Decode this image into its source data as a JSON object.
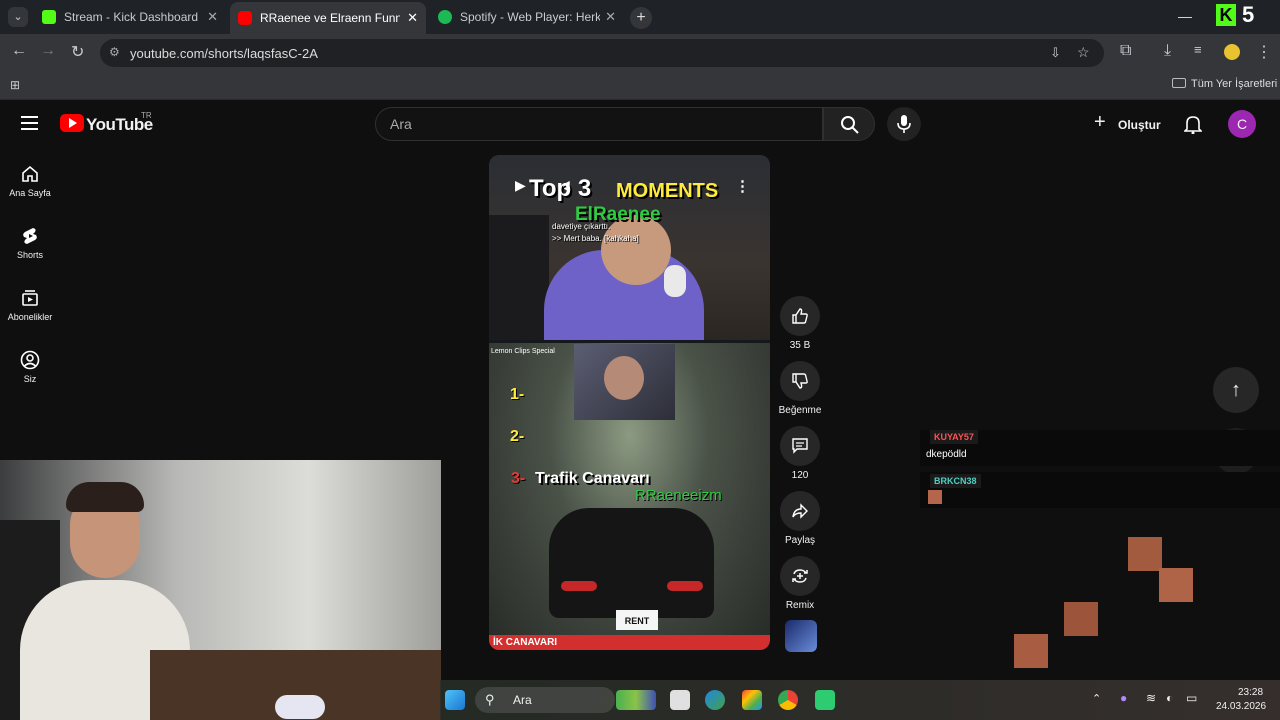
{
  "browser": {
    "tabs": [
      {
        "title": "Stream - Kick Dashboard",
        "favicon_color": "#53fc18",
        "active": false
      },
      {
        "title": "RRaenee ve Elraenn Funny Mom",
        "favicon_color": "#ff0000",
        "active": true
      },
      {
        "title": "Spotify - Web Player: Herkes iç",
        "favicon_color": "#1db954",
        "active": false
      }
    ],
    "url": "youtube.com/shorts/laqsfasC-2A",
    "bookmarks_label": "Tüm Yer İşaretleri",
    "kick_overlay": {
      "logo": "K",
      "count": "5"
    }
  },
  "youtube": {
    "logo_text": "YouTube",
    "region": "TR",
    "search_placeholder": "Ara",
    "create_label": "Oluştur",
    "avatar_letter": "C",
    "sidebar": [
      {
        "label": "Ana Sayfa",
        "icon": "home-icon"
      },
      {
        "label": "Shorts",
        "icon": "shorts-icon"
      },
      {
        "label": "Abonelikler",
        "icon": "subscriptions-icon"
      },
      {
        "label": "Siz",
        "icon": "you-icon"
      }
    ],
    "short": {
      "title_top": "Top 3",
      "title_moments": "MOMENTS",
      "channel_overlay": "ElRaenee",
      "caption_1": "davetiye çıkarttı.",
      "caption_2": ">> Mert baba. [kahkaha]",
      "clip_source": "Lemon Clips Special",
      "rank_1": "1-",
      "rank_2": "2-",
      "rank_3": "3-",
      "rank_3_title": "Trafik Canavarı",
      "watermark": "RRaeneeizm",
      "plate": "RENT",
      "bottom_banner": "İK CANAVARI"
    },
    "actions": [
      {
        "label": "35 B",
        "icon": "thumbs-up-icon"
      },
      {
        "label": "Beğenme",
        "icon": "thumbs-down-icon"
      },
      {
        "label": "120",
        "icon": "comment-icon"
      },
      {
        "label": "Paylaş",
        "icon": "share-icon"
      },
      {
        "label": "Remix",
        "icon": "remix-icon"
      }
    ]
  },
  "stream_chat": [
    {
      "user": "KUYAY57",
      "user_color": "#e53935",
      "message": "dkepödld"
    },
    {
      "user": "BRKCN38",
      "user_color": "#26a69a",
      "message": ""
    }
  ],
  "taskbar": {
    "search_label": "Ara",
    "time": "23:28",
    "date": "24.03.2026"
  }
}
